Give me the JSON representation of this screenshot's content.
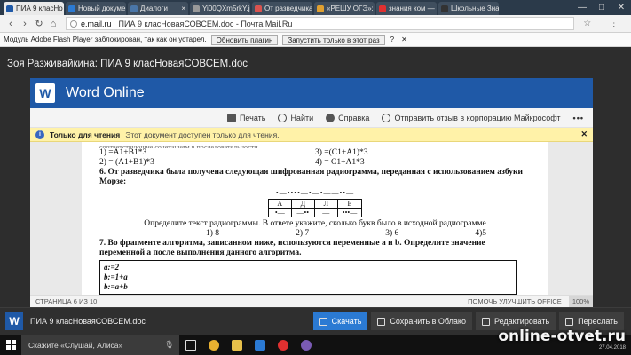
{
  "browser": {
    "tabs": [
      {
        "label": "ПИА 9 класНо",
        "color": "#1f59a7",
        "active": true
      },
      {
        "label": "Новый докумен",
        "color": "#2b7ad3"
      },
      {
        "label": "Диалоги",
        "color": "#4a76a8"
      },
      {
        "label": "Yi00QXm5rkY.jp",
        "color": "#999999"
      },
      {
        "label": "От разведчика б",
        "color": "#d9534f"
      },
      {
        "label": "«РЕШУ ОГЭ»: ин",
        "color": "#e0a030"
      },
      {
        "label": "знания ком — Я",
        "color": "#e03030"
      },
      {
        "label": "Школьные Знан",
        "color": "#333333"
      }
    ],
    "window_controls": [
      "—",
      "□",
      "✕"
    ],
    "url": {
      "domain": "e.mail.ru",
      "title": "ПИА 9 класНоваяСОВСЕМ.doc - Почта Mail.Ru"
    },
    "flash": {
      "message": "Модуль Adobe Flash Player заблокирован, так как он устарел.",
      "update_label": "Обновить плагин",
      "run_label": "Запустить только в этот раз",
      "help": "?",
      "close": "✕"
    }
  },
  "page": {
    "owner_title": "Зоя Разживайкина: ПИА 9 класНоваяСОВСЕМ.doc"
  },
  "word_online": {
    "logo_letter": "W",
    "title": "Word Online",
    "toolbar": {
      "print": "Печать",
      "find": "Найти",
      "help": "Справка",
      "feedback": "Отправить отзыв в корпорацию Майкрософт",
      "more": "•••"
    },
    "readonly": {
      "icon": "i",
      "label": "Только для чтения",
      "text": "Этот документ доступен только для чтения.",
      "close": "✕"
    },
    "doc": {
      "cut_line": "соответствующие сочетаниям в последовательности...",
      "options": [
        "1) =A1+B1*3",
        "3) =(C1+A1)*3",
        "2) = (A1+B1)*3",
        "4) = C1+A1*3"
      ],
      "q6": "6. От разведчика была получена следующая шифрованная радиограмма, переданная с использованием азбуки Морзе:",
      "morse": "•—••••—•—•——••—",
      "table_letters": [
        "А",
        "Д",
        "Л",
        "Е"
      ],
      "table_codes": [
        "•—",
        "—••",
        "—",
        "•••—"
      ],
      "answer_q": "Определите текст радиограммы. В ответе укажите, сколько букв было в исходной радиограмме",
      "choices": [
        "1) 8",
        "2) 7",
        "3) 6",
        "4)5"
      ],
      "q7": "7. Во фрагменте алгоритма, записанном ниже, используются переменные a и b. Определите значение переменной a после выполнения данного алгоритма.",
      "algo": [
        "a:=2",
        "b:=1+a",
        "b:=a+b"
      ]
    },
    "status": {
      "page": "СТРАНИЦА 6 ИЗ 10",
      "improve": "ПОМОЧЬ УЛУЧШИТЬ OFFICE",
      "zoom": "100%"
    }
  },
  "actionbar": {
    "logo_letter": "W",
    "filename": "ПИА 9 класНоваяСОВСЕМ.doc",
    "download": "Скачать",
    "save_cloud": "Сохранить в Облако",
    "edit": "Редактировать",
    "forward": "Переслать"
  },
  "taskbar": {
    "search_placeholder": "Скажите «Слушай, Алиса»",
    "mic": "🎙",
    "date": "27.04.2018"
  },
  "watermark": "online-otvet.ru"
}
